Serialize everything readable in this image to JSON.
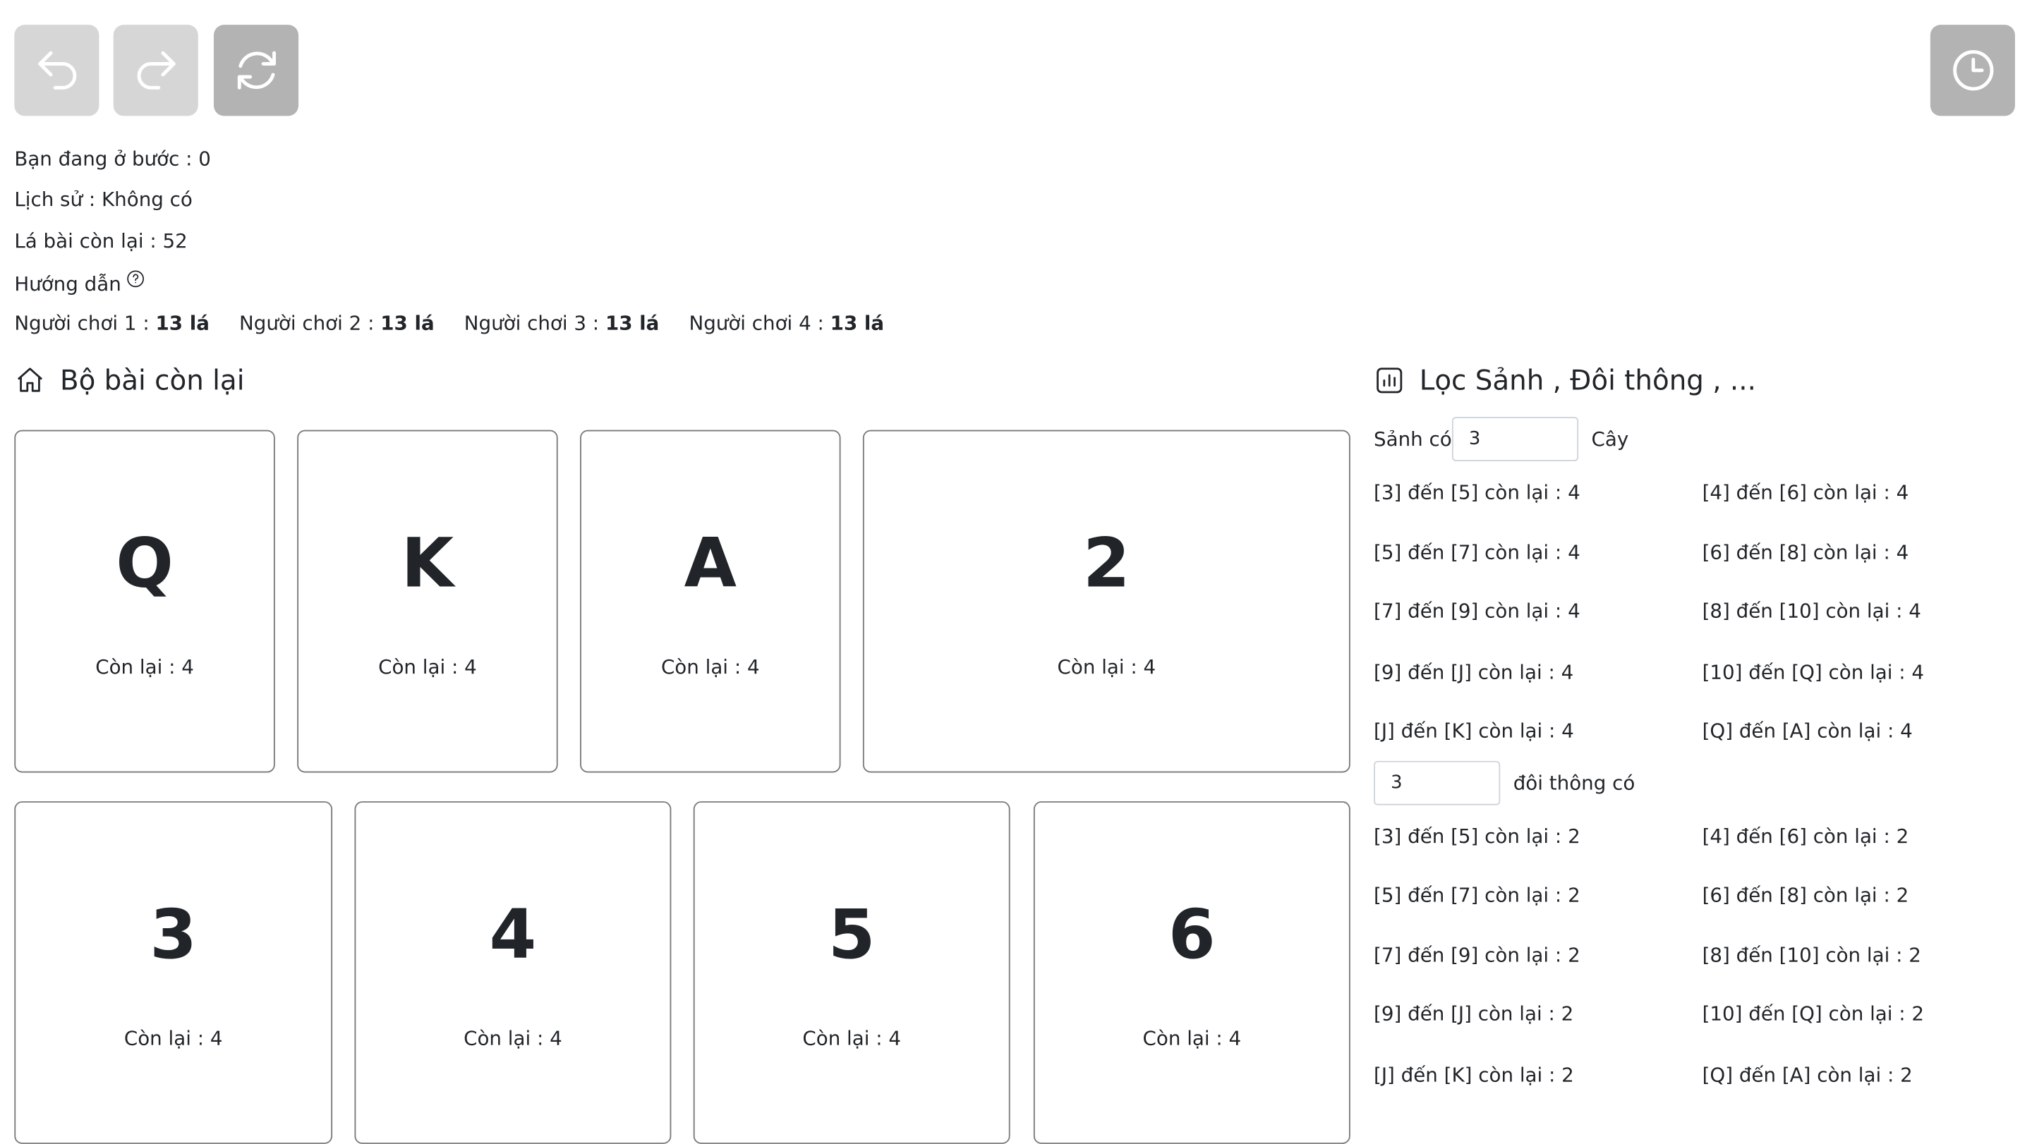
{
  "toolbar": {
    "undo_icon": "undo-icon",
    "redo_icon": "redo-icon",
    "refresh_icon": "refresh-icon",
    "history_icon": "clock-icon"
  },
  "info": {
    "step": "Bạn đang ở bước : 0",
    "history": "Lịch sử : Không có",
    "remaining": "Lá bài còn lại : 52",
    "guide": "Hướng dẫn"
  },
  "players": [
    {
      "label": "Người chơi 1 : ",
      "count": "13 lá"
    },
    {
      "label": "Người chơi 2 : ",
      "count": "13 lá"
    },
    {
      "label": "Người chơi 3 : ",
      "count": "13 lá"
    },
    {
      "label": "Người chơi 4 : ",
      "count": "13 lá"
    }
  ],
  "deck": {
    "title": "Bộ bài còn lại",
    "cards": [
      {
        "rank": "Q",
        "count": "Còn lại : 4"
      },
      {
        "rank": "K",
        "count": "Còn lại : 4"
      },
      {
        "rank": "A",
        "count": "Còn lại : 4"
      },
      {
        "rank": "2",
        "count": "Còn lại : 4"
      },
      {
        "rank": "3",
        "count": "Còn lại : 4"
      },
      {
        "rank": "4",
        "count": "Còn lại : 4"
      },
      {
        "rank": "5",
        "count": "Còn lại : 4"
      },
      {
        "rank": "6",
        "count": "Còn lại : 4"
      }
    ]
  },
  "filter": {
    "title": "Lọc Sảnh , Đôi thông , ...",
    "straight": {
      "label_before": "Sảnh có",
      "value": "3",
      "label_after": "Cây",
      "results": [
        "[3] đến [5] còn lại : 4",
        "[4] đến [6] còn lại : 4",
        "[5] đến [7] còn lại : 4",
        "[6] đến [8] còn lại : 4",
        "[7] đến [9] còn lại : 4",
        "[8] đến [10] còn lại : 4",
        "[9] đến [J] còn lại : 4",
        "[10] đến [Q] còn lại : 4",
        "[J] đến [K] còn lại : 4",
        "[Q] đến [A] còn lại : 4"
      ]
    },
    "pairs": {
      "value": "3",
      "label_after": "đôi thông có",
      "results": [
        "[3] đến [5] còn lại : 2",
        "[4] đến [6] còn lại : 2",
        "[5] đến [7] còn lại : 2",
        "[6] đến [8] còn lại : 2",
        "[7] đến [9] còn lại : 2",
        "[8] đến [10] còn lại : 2",
        "[9] đến [J] còn lại : 2",
        "[10] đến [Q] còn lại : 2",
        "[J] đến [K] còn lại : 2",
        "[Q] đến [A] còn lại : 2"
      ]
    }
  }
}
